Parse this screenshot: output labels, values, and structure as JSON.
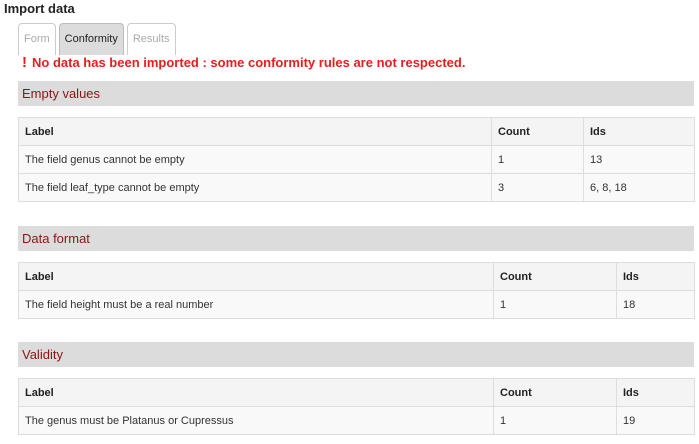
{
  "page_title": "Import data",
  "tabs": [
    {
      "label": "Form"
    },
    {
      "label": "Conformity"
    },
    {
      "label": "Results"
    }
  ],
  "error": {
    "icon": "!",
    "message": "No data has been imported : some conformity rules are not respected."
  },
  "columns": {
    "label": "Label",
    "count": "Count",
    "ids": "Ids"
  },
  "sections": [
    {
      "title": "Empty values",
      "rows": [
        {
          "label": "The field genus cannot be empty",
          "count": "1",
          "ids": "13"
        },
        {
          "label": "The field leaf_type cannot be empty",
          "count": "3",
          "ids": "6, 8, 18"
        }
      ]
    },
    {
      "title": "Data format",
      "rows": [
        {
          "label": "The field height must be a real number",
          "count": "1",
          "ids": "18"
        }
      ]
    },
    {
      "title": "Validity",
      "rows": [
        {
          "label": "The genus must be Platanus or Cupressus",
          "count": "1",
          "ids": "19"
        }
      ]
    }
  ]
}
